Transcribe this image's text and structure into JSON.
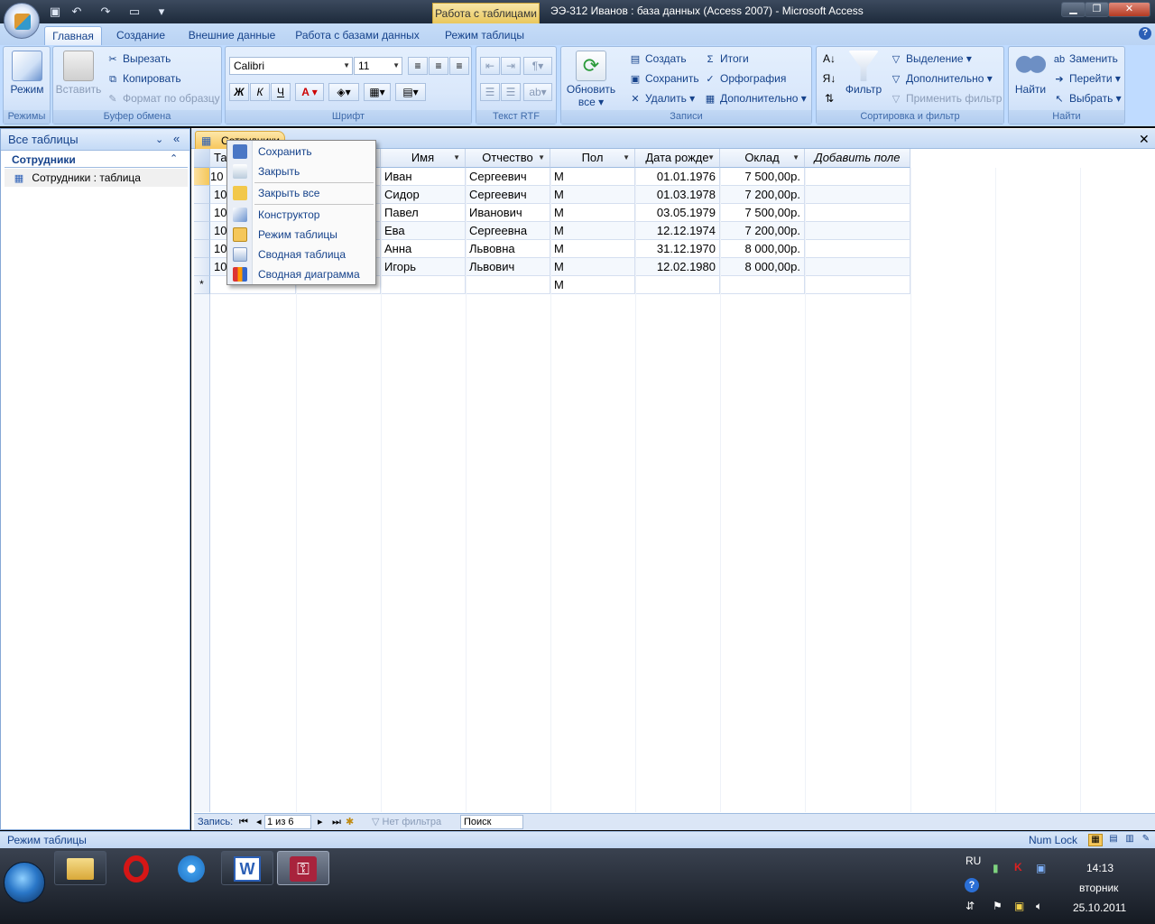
{
  "window": {
    "title": "ЭЭ-312 Иванов : база данных (Access 2007) - Microsoft Access",
    "context_tab_label": "Работа с таблицами"
  },
  "ribbon": {
    "tabs": [
      "Главная",
      "Создание",
      "Внешние данные",
      "Работа с базами данных",
      "Режим таблицы"
    ],
    "active_tab": "Главная",
    "groups": {
      "views": {
        "label": "Режимы",
        "mode_button": "Режим"
      },
      "clipboard": {
        "label": "Буфер обмена",
        "paste": "Вставить",
        "cut": "Вырезать",
        "copy": "Копировать",
        "format_painter": "Формат по образцу"
      },
      "font": {
        "label": "Шрифт",
        "font_name": "Calibri",
        "font_size": "11",
        "bold": "Ж",
        "italic": "К",
        "underline": "Ч",
        "font_color": "A"
      },
      "rtf": {
        "label": "Текст RTF"
      },
      "records": {
        "label": "Записи",
        "refresh_all": "Обновить все",
        "new": "Создать",
        "save": "Сохранить",
        "delete": "Удалить",
        "totals": "Итоги",
        "spelling": "Орфография",
        "more": "Дополнительно"
      },
      "sort_filter": {
        "label": "Сортировка и фильтр",
        "filter": "Фильтр",
        "selection": "Выделение",
        "advanced": "Дополнительно",
        "toggle_filter": "Применить фильтр"
      },
      "find": {
        "label": "Найти",
        "find": "Найти",
        "replace": "Заменить",
        "goto": "Перейти",
        "select": "Выбрать"
      }
    }
  },
  "nav_pane": {
    "header": "Все таблицы",
    "group": "Сотрудники",
    "items": [
      "Сотрудники : таблица"
    ]
  },
  "document": {
    "tab_label": "Сотрудники",
    "columns": [
      "Та",
      "",
      "Имя",
      "Отчество",
      "Пол",
      "Дата рожде",
      "Оклад",
      "Добавить поле"
    ],
    "rows": [
      {
        "id": "10",
        "name": "Иван",
        "patronymic": "Сергеевич",
        "sex": "М",
        "birth": "01.01.1976",
        "salary": "7 500,00р."
      },
      {
        "id": "10",
        "name": "Сидор",
        "patronymic": "Сергеевич",
        "sex": "М",
        "birth": "01.03.1978",
        "salary": "7 200,00р."
      },
      {
        "id": "10",
        "name": "Павел",
        "patronymic": "Иванович",
        "sex": "М",
        "birth": "03.05.1979",
        "salary": "7 500,00р."
      },
      {
        "id": "10",
        "name": "Ева",
        "patronymic": "Сергеевна",
        "sex": "М",
        "birth": "12.12.1974",
        "salary": "7 200,00р."
      },
      {
        "id": "10",
        "name": "Анна",
        "patronymic": "Львовна",
        "sex": "М",
        "birth": "31.12.1970",
        "salary": "8 000,00р."
      },
      {
        "id": "10",
        "name": "Игорь",
        "patronymic": "Львович",
        "sex": "М",
        "birth": "12.02.1980",
        "salary": "8 000,00р."
      }
    ],
    "new_row_marker": "*",
    "new_row_sex": "М"
  },
  "context_menu": {
    "items": [
      "Сохранить",
      "Закрыть",
      "Закрыть все",
      "Конструктор",
      "Режим таблицы",
      "Сводная таблица",
      "Сводная диаграмма"
    ]
  },
  "record_nav": {
    "label": "Запись:",
    "position": "1 из 6",
    "filter_status": "Нет фильтра",
    "search_placeholder": "Поиск"
  },
  "status_bar": {
    "left": "Режим таблицы",
    "num_lock": "Num Lock"
  },
  "taskbar": {
    "language": "RU",
    "time": "14:13",
    "day": "вторник",
    "date": "25.10.2011"
  }
}
